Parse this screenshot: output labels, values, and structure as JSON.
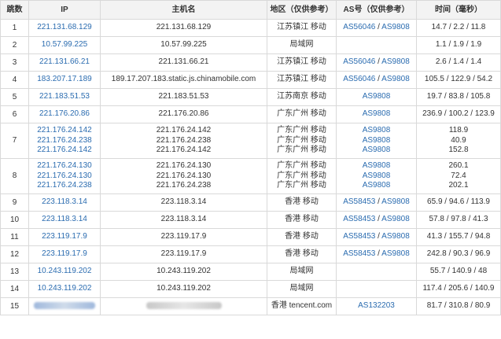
{
  "headers": {
    "hop": "跳数",
    "ip": "IP",
    "host": "主机名",
    "region": "地区（仅供参考）",
    "as": "AS号（仅供参考）",
    "time": "时间（毫秒）"
  },
  "rows": [
    {
      "hop": "1",
      "ips": [
        "221.131.68.129"
      ],
      "hosts": [
        "221.131.68.129"
      ],
      "regions": [
        "江苏镇江 移动"
      ],
      "as": [
        [
          "AS56046",
          "AS9808"
        ]
      ],
      "times": [
        "14.7 / 2.2 / 11.8"
      ]
    },
    {
      "hop": "2",
      "ips": [
        "10.57.99.225"
      ],
      "hosts": [
        "10.57.99.225"
      ],
      "regions": [
        "局域网"
      ],
      "as": [
        []
      ],
      "times": [
        "1.1 / 1.9 / 1.9"
      ]
    },
    {
      "hop": "3",
      "ips": [
        "221.131.66.21"
      ],
      "hosts": [
        "221.131.66.21"
      ],
      "regions": [
        "江苏镇江 移动"
      ],
      "as": [
        [
          "AS56046",
          "AS9808"
        ]
      ],
      "times": [
        "2.6 / 1.4 / 1.4"
      ]
    },
    {
      "hop": "4",
      "ips": [
        "183.207.17.189"
      ],
      "hosts": [
        "189.17.207.183.static.js.chinamobile.com"
      ],
      "regions": [
        "江苏镇江 移动"
      ],
      "as": [
        [
          "AS56046",
          "AS9808"
        ]
      ],
      "times": [
        "105.5 / 122.9 / 54.2"
      ]
    },
    {
      "hop": "5",
      "ips": [
        "221.183.51.53"
      ],
      "hosts": [
        "221.183.51.53"
      ],
      "regions": [
        "江苏南京 移动"
      ],
      "as": [
        [
          "AS9808"
        ]
      ],
      "times": [
        "19.7 / 83.8 / 105.8"
      ]
    },
    {
      "hop": "6",
      "ips": [
        "221.176.20.86"
      ],
      "hosts": [
        "221.176.20.86"
      ],
      "regions": [
        "广东广州 移动"
      ],
      "as": [
        [
          "AS9808"
        ]
      ],
      "times": [
        "236.9 / 100.2 / 123.9"
      ]
    },
    {
      "hop": "7",
      "ips": [
        "221.176.24.142",
        "221.176.24.238",
        "221.176.24.142"
      ],
      "hosts": [
        "221.176.24.142",
        "221.176.24.238",
        "221.176.24.142"
      ],
      "regions": [
        "广东广州 移动",
        "广东广州 移动",
        "广东广州 移动"
      ],
      "as": [
        [
          "AS9808"
        ],
        [
          "AS9808"
        ],
        [
          "AS9808"
        ]
      ],
      "times": [
        "118.9",
        "40.9",
        "152.8"
      ]
    },
    {
      "hop": "8",
      "ips": [
        "221.176.24.130",
        "221.176.24.130",
        "221.176.24.238"
      ],
      "hosts": [
        "221.176.24.130",
        "221.176.24.130",
        "221.176.24.238"
      ],
      "regions": [
        "广东广州 移动",
        "广东广州 移动",
        "广东广州 移动"
      ],
      "as": [
        [
          "AS9808"
        ],
        [
          "AS9808"
        ],
        [
          "AS9808"
        ]
      ],
      "times": [
        "260.1",
        "72.4",
        "202.1"
      ]
    },
    {
      "hop": "9",
      "ips": [
        "223.118.3.14"
      ],
      "hosts": [
        "223.118.3.14"
      ],
      "regions": [
        "香港 移动"
      ],
      "as": [
        [
          "AS58453",
          "AS9808"
        ]
      ],
      "times": [
        "65.9 / 94.6 / 113.9"
      ]
    },
    {
      "hop": "10",
      "ips": [
        "223.118.3.14"
      ],
      "hosts": [
        "223.118.3.14"
      ],
      "regions": [
        "香港 移动"
      ],
      "as": [
        [
          "AS58453",
          "AS9808"
        ]
      ],
      "times": [
        "57.8 / 97.8 / 41.3"
      ]
    },
    {
      "hop": "11",
      "ips": [
        "223.119.17.9"
      ],
      "hosts": [
        "223.119.17.9"
      ],
      "regions": [
        "香港 移动"
      ],
      "as": [
        [
          "AS58453",
          "AS9808"
        ]
      ],
      "times": [
        "41.3 / 155.7 / 94.8"
      ]
    },
    {
      "hop": "12",
      "ips": [
        "223.119.17.9"
      ],
      "hosts": [
        "223.119.17.9"
      ],
      "regions": [
        "香港 移动"
      ],
      "as": [
        [
          "AS58453",
          "AS9808"
        ]
      ],
      "times": [
        "242.8 / 90.3 / 96.9"
      ]
    },
    {
      "hop": "13",
      "ips": [
        "10.243.119.202"
      ],
      "hosts": [
        "10.243.119.202"
      ],
      "regions": [
        "局域网"
      ],
      "as": [
        []
      ],
      "times": [
        "55.7 / 140.9 / 48"
      ]
    },
    {
      "hop": "14",
      "ips": [
        "10.243.119.202"
      ],
      "hosts": [
        "10.243.119.202"
      ],
      "regions": [
        "局域网"
      ],
      "as": [
        []
      ],
      "times": [
        "117.4 / 205.6 / 140.9"
      ]
    },
    {
      "hop": "15",
      "ips": [
        ""
      ],
      "hosts": [
        ""
      ],
      "regions": [
        "香港 tencent.com"
      ],
      "as": [
        [
          "AS132203"
        ]
      ],
      "times": [
        "81.7 / 310.8 / 80.9"
      ]
    }
  ],
  "colors": {
    "link": "#2b6cb0",
    "border": "#d9d9d9",
    "header_bg": "#f3f3f3"
  }
}
